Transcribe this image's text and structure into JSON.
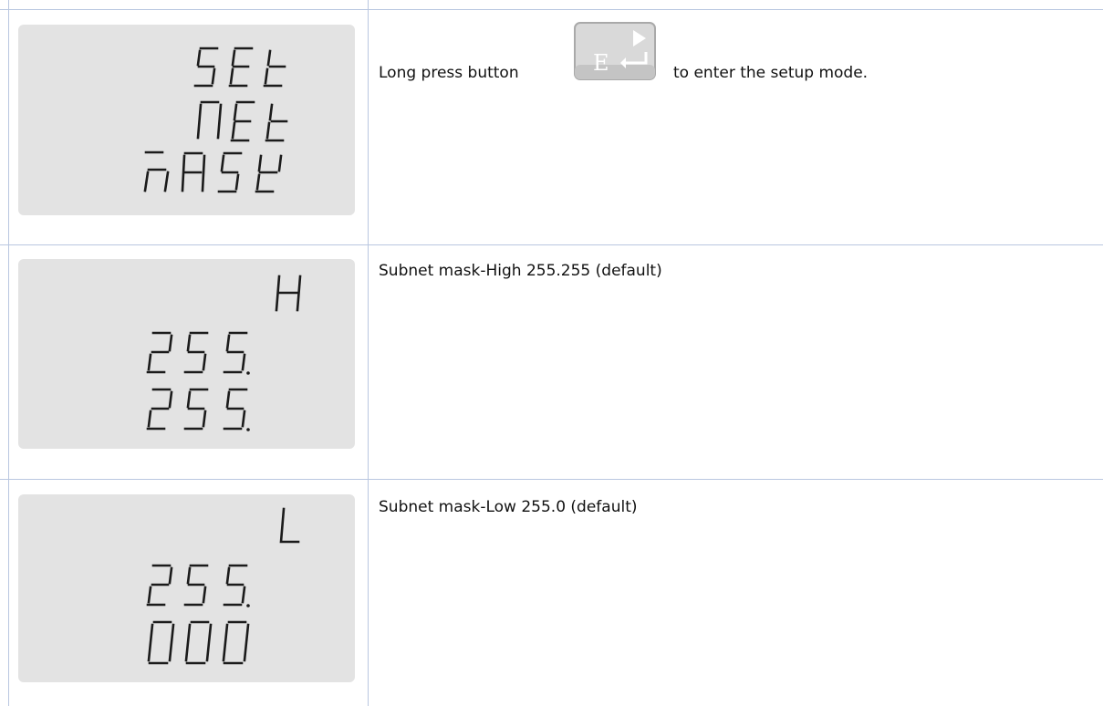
{
  "rows": [
    {
      "lcd_lines": [
        "SEt",
        "nEt",
        "nASK"
      ],
      "desc_before": "Long press button",
      "button": {
        "glyph": "E",
        "icon": "right-arrow-and-enter-icon"
      },
      "desc_after": "to enter the setup mode."
    },
    {
      "lcd_lines": [
        "H",
        "255.",
        "255."
      ],
      "desc": "Subnet mask-High 255.255 (default)"
    },
    {
      "lcd_lines": [
        "L",
        "255.",
        "000"
      ],
      "desc": "Subnet mask-Low 255.0 (default)"
    }
  ]
}
